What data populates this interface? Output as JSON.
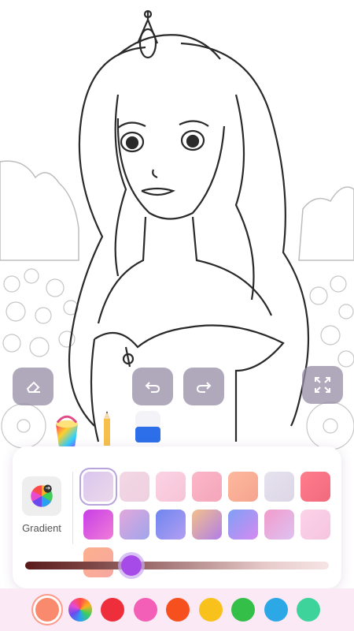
{
  "toolbar": {
    "eraser_icon": "eraser-icon",
    "undo_icon": "undo-icon",
    "redo_icon": "redo-icon",
    "fullscreen_icon": "expand-icon"
  },
  "tools": [
    {
      "name": "bucket",
      "icon": "paint-bucket-icon",
      "selected": true
    },
    {
      "name": "pencil",
      "icon": "pencil-icon",
      "selected": false
    },
    {
      "name": "eraser",
      "icon": "eraser-tool-icon",
      "selected": false
    }
  ],
  "panel": {
    "mode_label": "Gradient",
    "gradient_swatches": [
      [
        "#d9c6ee",
        "#ecd8ea"
      ],
      [
        "#f3d7e4",
        "#eed0e0"
      ],
      [
        "#fbd3e4",
        "#f6c4d6"
      ],
      [
        "#fbb7c7",
        "#f5a5bb"
      ],
      [
        "#fdb89c",
        "#f5a490"
      ],
      [
        "#e6e2ee",
        "#dcd6e6"
      ],
      [
        "#ff7d8c",
        "#f06a7e"
      ],
      [
        "#c83ee6",
        "#f07cd8"
      ],
      [
        "#e3a7dc",
        "#9fa6ec"
      ],
      [
        "#6e86f0",
        "#b39ef2"
      ],
      [
        "#f3c08a",
        "#b07ee8"
      ],
      [
        "#7ea0f5",
        "#d68af2"
      ],
      [
        "#f29bcb",
        "#ddc2f2"
      ],
      [
        "#fbd3e8",
        "#f6c4e0"
      ],
      [
        "#fdb08c",
        "#f7a7a2"
      ]
    ],
    "selected_swatch": 0,
    "slider_value": 0.35
  },
  "palette": {
    "colors": [
      "#fa8a6e",
      "rainbow",
      "#ee2e3a",
      "#f35fb6",
      "#f6501e",
      "#f8c11c",
      "#34bf49",
      "#2da8e6",
      "#3dd39a"
    ],
    "selected": 0
  }
}
